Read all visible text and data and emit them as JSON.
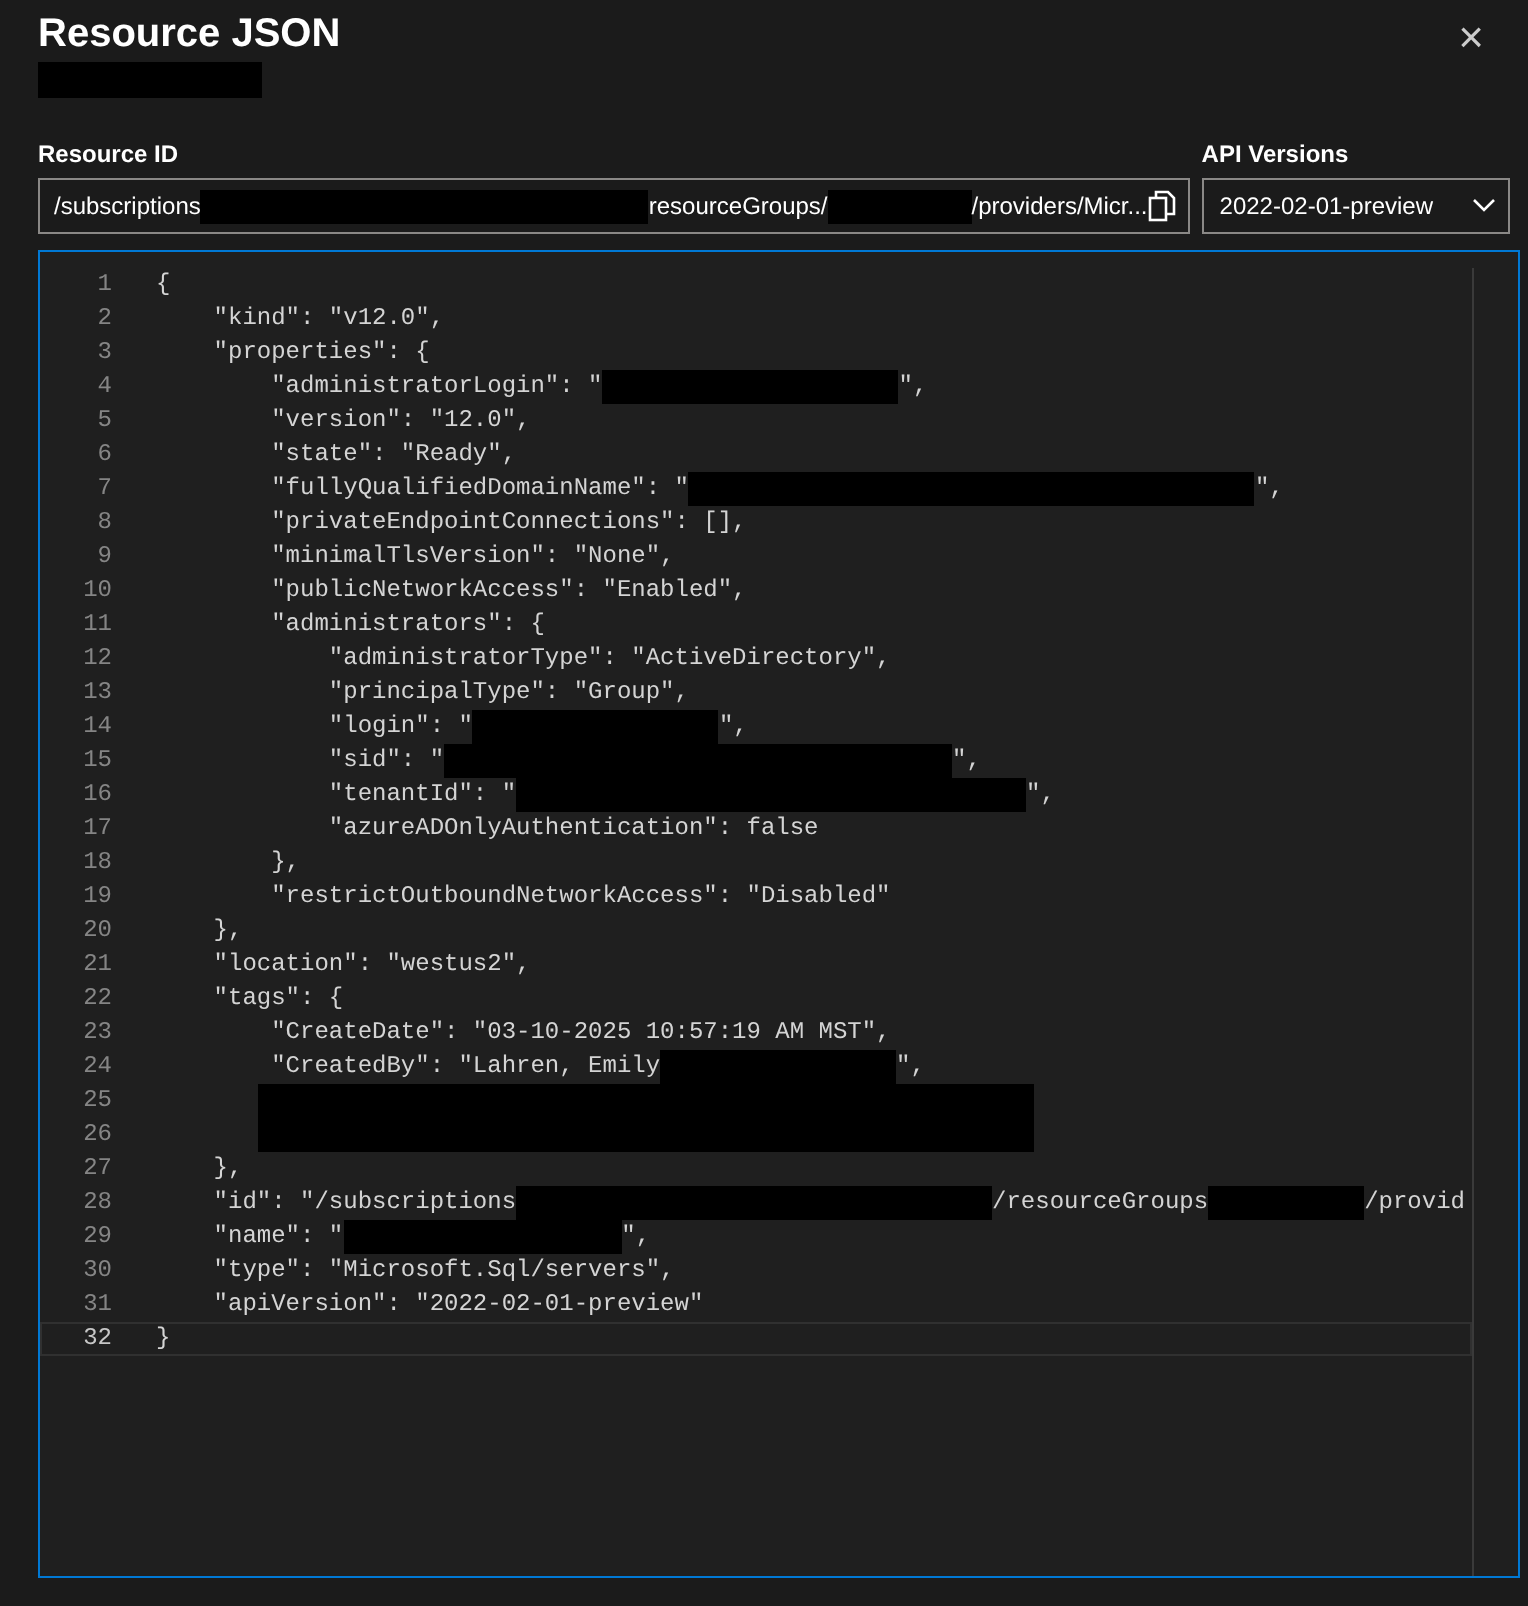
{
  "dialog": {
    "title": "Resource JSON",
    "close": "×"
  },
  "resource_id": {
    "label": "Resource ID",
    "segments": [
      {
        "kind": "text",
        "text": "/subscriptions"
      },
      {
        "kind": "redacted"
      },
      {
        "kind": "text",
        "text": "resourceGroups/"
      },
      {
        "kind": "redacted"
      },
      {
        "kind": "text",
        "text": "/providers/Micr..."
      }
    ]
  },
  "api_versions": {
    "label": "API Versions",
    "value": "2022-02-01-preview"
  },
  "editor": {
    "lines": [
      {
        "number": "1",
        "current": false,
        "segments": [
          {
            "kind": "text",
            "text": "{"
          }
        ]
      },
      {
        "number": "2",
        "current": false,
        "segments": [
          {
            "kind": "text",
            "text": "    \"kind\": \"v12.0\","
          }
        ]
      },
      {
        "number": "3",
        "current": false,
        "segments": [
          {
            "kind": "text",
            "text": "    \"properties\": {"
          }
        ]
      },
      {
        "number": "4",
        "current": false,
        "segments": [
          {
            "kind": "text",
            "text": "        \"administratorLogin\": \""
          },
          {
            "kind": "redacted"
          },
          {
            "kind": "text",
            "text": "\","
          }
        ]
      },
      {
        "number": "5",
        "current": false,
        "segments": [
          {
            "kind": "text",
            "text": "        \"version\": \"12.0\","
          }
        ]
      },
      {
        "number": "6",
        "current": false,
        "segments": [
          {
            "kind": "text",
            "text": "        \"state\": \"Ready\","
          }
        ]
      },
      {
        "number": "7",
        "current": false,
        "segments": [
          {
            "kind": "text",
            "text": "        \"fullyQualifiedDomainName\": \""
          },
          {
            "kind": "redacted"
          },
          {
            "kind": "text",
            "text": "\","
          }
        ]
      },
      {
        "number": "8",
        "current": false,
        "segments": [
          {
            "kind": "text",
            "text": "        \"privateEndpointConnections\": [],"
          }
        ]
      },
      {
        "number": "9",
        "current": false,
        "segments": [
          {
            "kind": "text",
            "text": "        \"minimalTlsVersion\": \"None\","
          }
        ]
      },
      {
        "number": "10",
        "current": false,
        "segments": [
          {
            "kind": "text",
            "text": "        \"publicNetworkAccess\": \"Enabled\","
          }
        ]
      },
      {
        "number": "11",
        "current": false,
        "segments": [
          {
            "kind": "text",
            "text": "        \"administrators\": {"
          }
        ]
      },
      {
        "number": "12",
        "current": false,
        "segments": [
          {
            "kind": "text",
            "text": "            \"administratorType\": \"ActiveDirectory\","
          }
        ]
      },
      {
        "number": "13",
        "current": false,
        "segments": [
          {
            "kind": "text",
            "text": "            \"principalType\": \"Group\","
          }
        ]
      },
      {
        "number": "14",
        "current": false,
        "segments": [
          {
            "kind": "text",
            "text": "            \"login\": \""
          },
          {
            "kind": "redacted"
          },
          {
            "kind": "text",
            "text": "\","
          }
        ]
      },
      {
        "number": "15",
        "current": false,
        "segments": [
          {
            "kind": "text",
            "text": "            \"sid\": \""
          },
          {
            "kind": "redacted"
          },
          {
            "kind": "text",
            "text": "\","
          }
        ]
      },
      {
        "number": "16",
        "current": false,
        "segments": [
          {
            "kind": "text",
            "text": "            \"tenantId\": \""
          },
          {
            "kind": "redacted"
          },
          {
            "kind": "text",
            "text": "\","
          }
        ]
      },
      {
        "number": "17",
        "current": false,
        "segments": [
          {
            "kind": "text",
            "text": "            \"azureADOnlyAuthentication\": false"
          }
        ]
      },
      {
        "number": "18",
        "current": false,
        "segments": [
          {
            "kind": "text",
            "text": "        },"
          }
        ]
      },
      {
        "number": "19",
        "current": false,
        "segments": [
          {
            "kind": "text",
            "text": "        \"restrictOutboundNetworkAccess\": \"Disabled\""
          }
        ]
      },
      {
        "number": "20",
        "current": false,
        "segments": [
          {
            "kind": "text",
            "text": "    },"
          }
        ]
      },
      {
        "number": "21",
        "current": false,
        "segments": [
          {
            "kind": "text",
            "text": "    \"location\": \"westus2\","
          }
        ]
      },
      {
        "number": "22",
        "current": false,
        "segments": [
          {
            "kind": "text",
            "text": "    \"tags\": {"
          }
        ]
      },
      {
        "number": "23",
        "current": false,
        "segments": [
          {
            "kind": "text",
            "text": "        \"CreateDate\": \"03-10-2025 10:57:19 AM MST\","
          }
        ]
      },
      {
        "number": "24",
        "current": false,
        "segments": [
          {
            "kind": "text",
            "text": "        \"CreatedBy\": \"Lahren, Emily"
          },
          {
            "kind": "redacted"
          },
          {
            "kind": "text",
            "text": "\","
          }
        ]
      },
      {
        "number": "25",
        "current": false,
        "segments": [
          {
            "kind": "redacted"
          }
        ]
      },
      {
        "number": "26",
        "current": false,
        "segments": [
          {
            "kind": "redacted"
          }
        ]
      },
      {
        "number": "27",
        "current": false,
        "segments": [
          {
            "kind": "text",
            "text": "    },"
          }
        ]
      },
      {
        "number": "28",
        "current": false,
        "segments": [
          {
            "kind": "text",
            "text": "    \"id\": \"/subscriptions"
          },
          {
            "kind": "redacted"
          },
          {
            "kind": "text",
            "text": "/resourceGroups"
          },
          {
            "kind": "redacted"
          },
          {
            "kind": "text",
            "text": "/provid"
          }
        ]
      },
      {
        "number": "29",
        "current": false,
        "segments": [
          {
            "kind": "text",
            "text": "    \"name\": \""
          },
          {
            "kind": "redacted"
          },
          {
            "kind": "text",
            "text": "\","
          }
        ]
      },
      {
        "number": "30",
        "current": false,
        "segments": [
          {
            "kind": "text",
            "text": "    \"type\": \"Microsoft.Sql/servers\","
          }
        ]
      },
      {
        "number": "31",
        "current": false,
        "segments": [
          {
            "kind": "text",
            "text": "    \"apiVersion\": \"2022-02-01-preview\""
          }
        ]
      },
      {
        "number": "32",
        "current": true,
        "segments": [
          {
            "kind": "text",
            "text": "}"
          }
        ]
      }
    ]
  }
}
